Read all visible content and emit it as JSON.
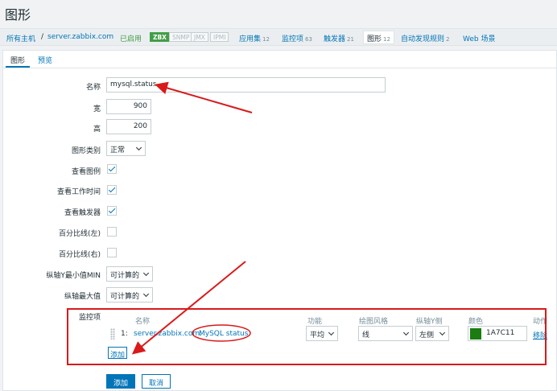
{
  "page": {
    "title": "图形"
  },
  "host_nav": {
    "all_hosts": "所有主机",
    "separator": "/",
    "host": "server.zabbix.com",
    "status": "已启用",
    "availability": [
      "ZBX",
      "SNMP",
      "JMX",
      "IPMI"
    ],
    "links": [
      {
        "label": "应用集",
        "count": "12"
      },
      {
        "label": "监控项",
        "count": "63"
      },
      {
        "label": "触发器",
        "count": "21"
      },
      {
        "label": "图形",
        "count": "12"
      },
      {
        "label": "自动发现规则",
        "count": "2"
      },
      {
        "label": "Web 场景",
        "count": ""
      }
    ]
  },
  "tabs": [
    {
      "label": "图形"
    },
    {
      "label": "预览"
    }
  ],
  "form": {
    "name": {
      "label": "名称",
      "value": "mysql.status"
    },
    "width": {
      "label": "宽",
      "value": "900"
    },
    "height": {
      "label": "高",
      "value": "200"
    },
    "graph_type": {
      "label": "图形类别",
      "value": "正常"
    },
    "show_legend": {
      "label": "查看图例",
      "checked": true
    },
    "show_working_time": {
      "label": "查看工作时间",
      "checked": true
    },
    "show_triggers": {
      "label": "查看触发器",
      "checked": true
    },
    "percentile_left": {
      "label": "百分比线(左)",
      "checked": false
    },
    "percentile_right": {
      "label": "百分比线(右)",
      "checked": false
    },
    "y_min": {
      "label": "纵轴Y最小值MIN",
      "value": "可计算的"
    },
    "y_max": {
      "label": "纵轴最大值",
      "value": "可计算的"
    }
  },
  "items": {
    "label": "监控项",
    "columns": [
      "名称",
      "功能",
      "绘图风格",
      "纵轴Y侧",
      "颜色",
      "动作"
    ],
    "rows": [
      {
        "index": "1:",
        "host": "server.zabbix.com:",
        "item": "MySQL status",
        "function": "平均",
        "draw_style": "线",
        "y_side": "左侧",
        "color": "1A7C11",
        "action": "移除"
      }
    ],
    "add_label": "添加"
  },
  "buttons": {
    "add": "添加",
    "cancel": "取消"
  },
  "colors": {
    "accent": "#0275b8",
    "enabled": "#429e47",
    "item_color": "#1a7c11",
    "annotation": "#d81a1a"
  }
}
